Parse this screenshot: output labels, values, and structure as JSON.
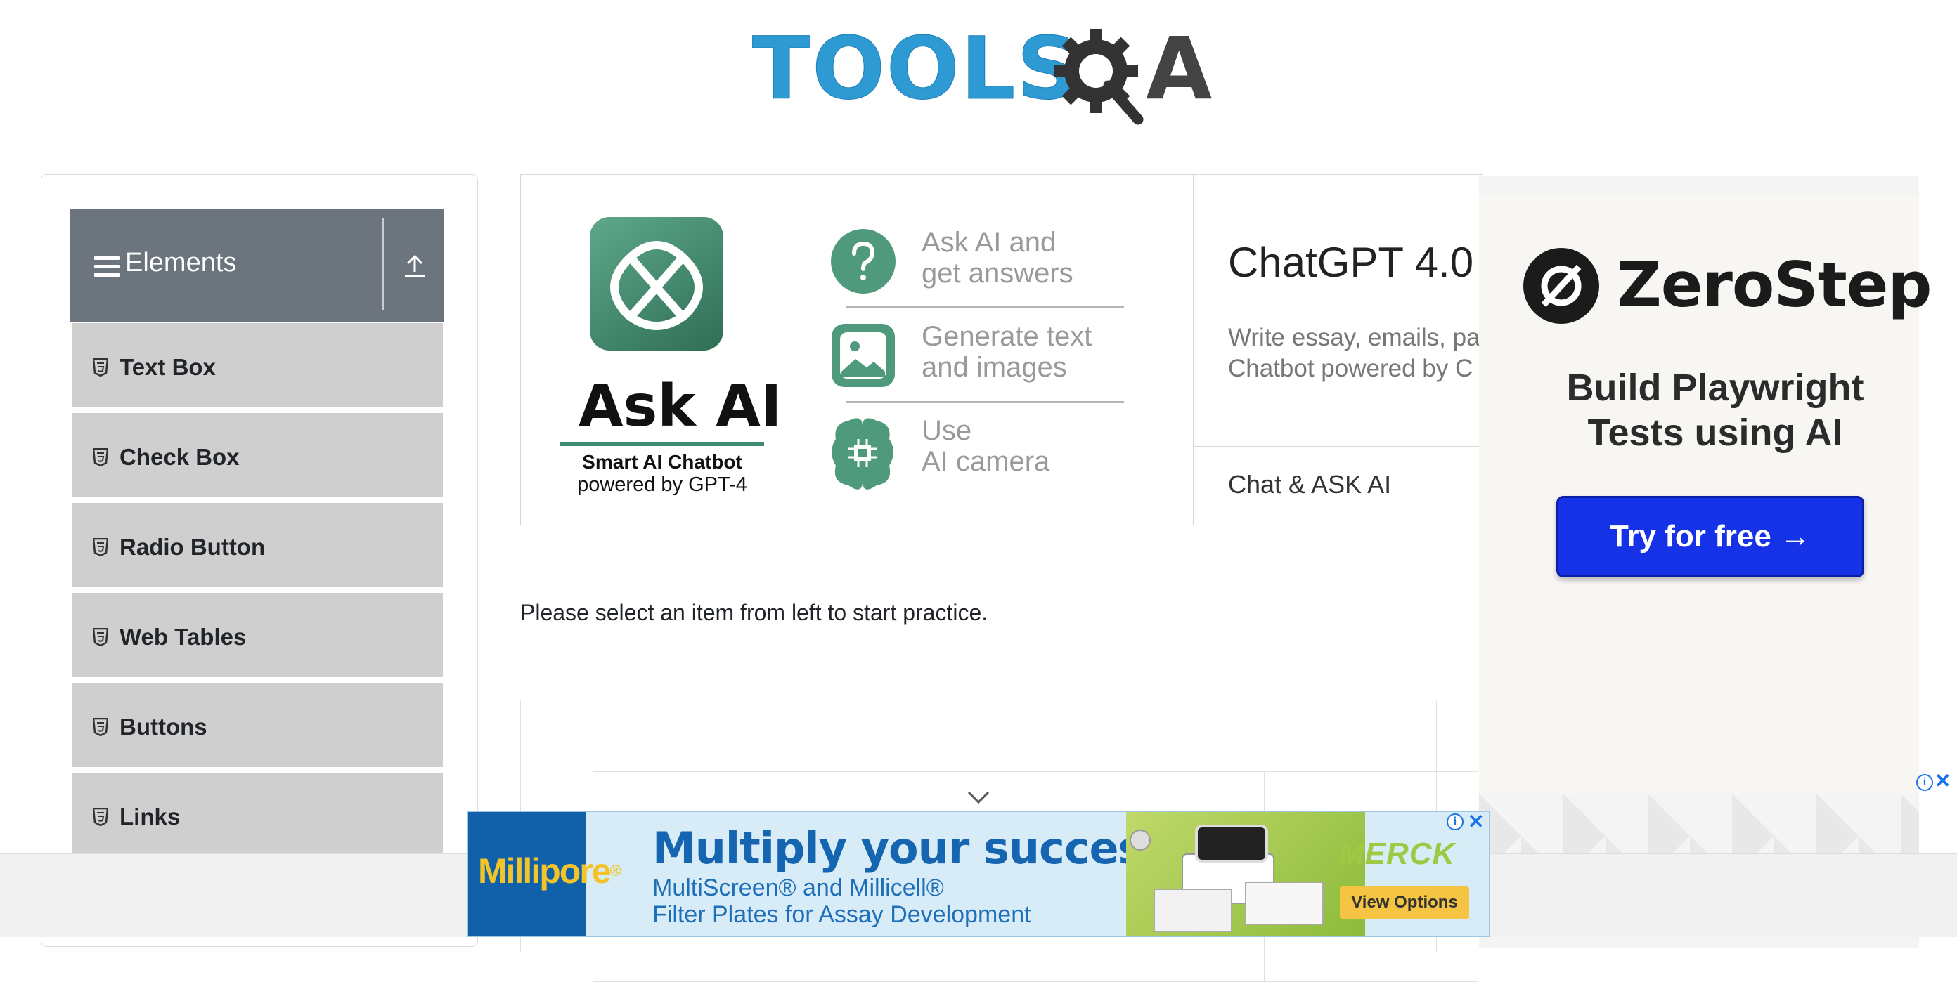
{
  "header": {
    "logo_text": "TOOLSQA",
    "logo_letters_left": "TOOLS",
    "logo_letters_right": "A"
  },
  "sidebar": {
    "group_title": "Elements",
    "items": [
      {
        "label": "Text Box"
      },
      {
        "label": "Check Box"
      },
      {
        "label": "Radio Button"
      },
      {
        "label": "Web Tables"
      },
      {
        "label": "Buttons"
      },
      {
        "label": "Links"
      }
    ]
  },
  "ai_banner": {
    "title": "Ask AI",
    "subtitle": "Smart AI Chatbot",
    "powered": "powered by GPT-4",
    "features": [
      {
        "line1": "Ask AI and",
        "line2": "get answers",
        "icon": "question-icon"
      },
      {
        "line1": "Generate text",
        "line2": "and images",
        "icon": "image-icon"
      },
      {
        "line1": "Use",
        "line2": "AI camera",
        "icon": "brain-chip-icon"
      }
    ],
    "product_title": "ChatGPT 4.0",
    "description_line1": "Write essay, emails, pa",
    "description_line2": "Chatbot powered by C",
    "link_label": "Chat & ASK AI"
  },
  "main": {
    "prompt": "Please select an item from left to start practice."
  },
  "right_ad": {
    "brand": "ZeroStep",
    "tagline_line1": "Build Playwright",
    "tagline_line2": "Tests using AI",
    "cta": "Try for free →"
  },
  "bottom_ad": {
    "logo": "Millipore",
    "logo_mark": "®",
    "headline": "Multiply your success",
    "line2": "MultiScreen® and Millicell®",
    "line3": "Filter Plates for Assay Development",
    "brand": "MERCK",
    "cta": "View Options",
    "info_glyph": "i",
    "close_glyph": "✕"
  },
  "colors": {
    "sidebar_header": "#6c757d",
    "menu_item": "#cfcfcf",
    "logo_blue": "#2d9ad3",
    "ai_green": "#3d8b70",
    "cta_blue": "#1532e6"
  }
}
